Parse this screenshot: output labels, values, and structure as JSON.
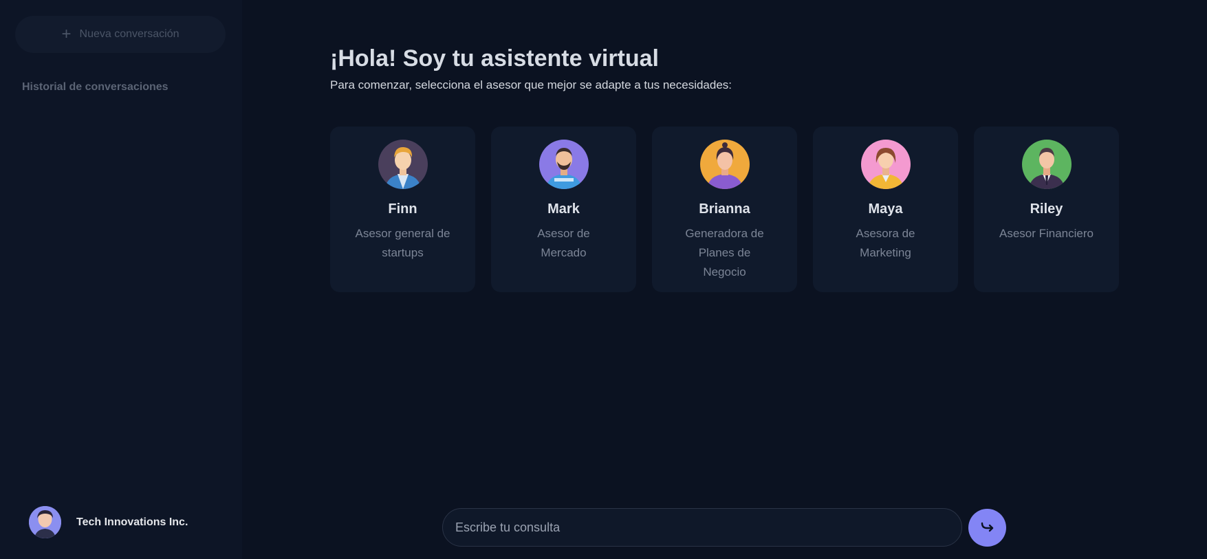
{
  "sidebar": {
    "new_conversation_label": "Nueva conversación",
    "history_title": "Historial de conversaciones",
    "user": {
      "name": "Tech Innovations Inc."
    }
  },
  "main": {
    "title": "¡Hola! Soy tu asistente virtual",
    "subtitle": "Para comenzar, selecciona el asesor que mejor se adapte a tus necesidades:",
    "advisors": [
      {
        "name": "Finn",
        "role": "Asesor general de startups",
        "avatar_bg": "#4a3f5c"
      },
      {
        "name": "Mark",
        "role": "Asesor de Mercado",
        "avatar_bg": "#8a7ae6"
      },
      {
        "name": "Brianna",
        "role": "Generadora de Planes de Negocio",
        "avatar_bg": "#f0a93c"
      },
      {
        "name": "Maya",
        "role": "Asesora de Marketing",
        "avatar_bg": "#f49ad0"
      },
      {
        "name": "Riley",
        "role": "Asesor Financiero",
        "avatar_bg": "#5db560"
      }
    ]
  },
  "chat_input": {
    "placeholder": "Escribe tu consulta"
  },
  "icons": {
    "new_conversation": "plus-icon",
    "send": "send-arrow-icon"
  },
  "colors": {
    "background": "#0b1221",
    "sidebar": "#0d1526",
    "card": "#101a2c",
    "accent": "#8385f5"
  }
}
